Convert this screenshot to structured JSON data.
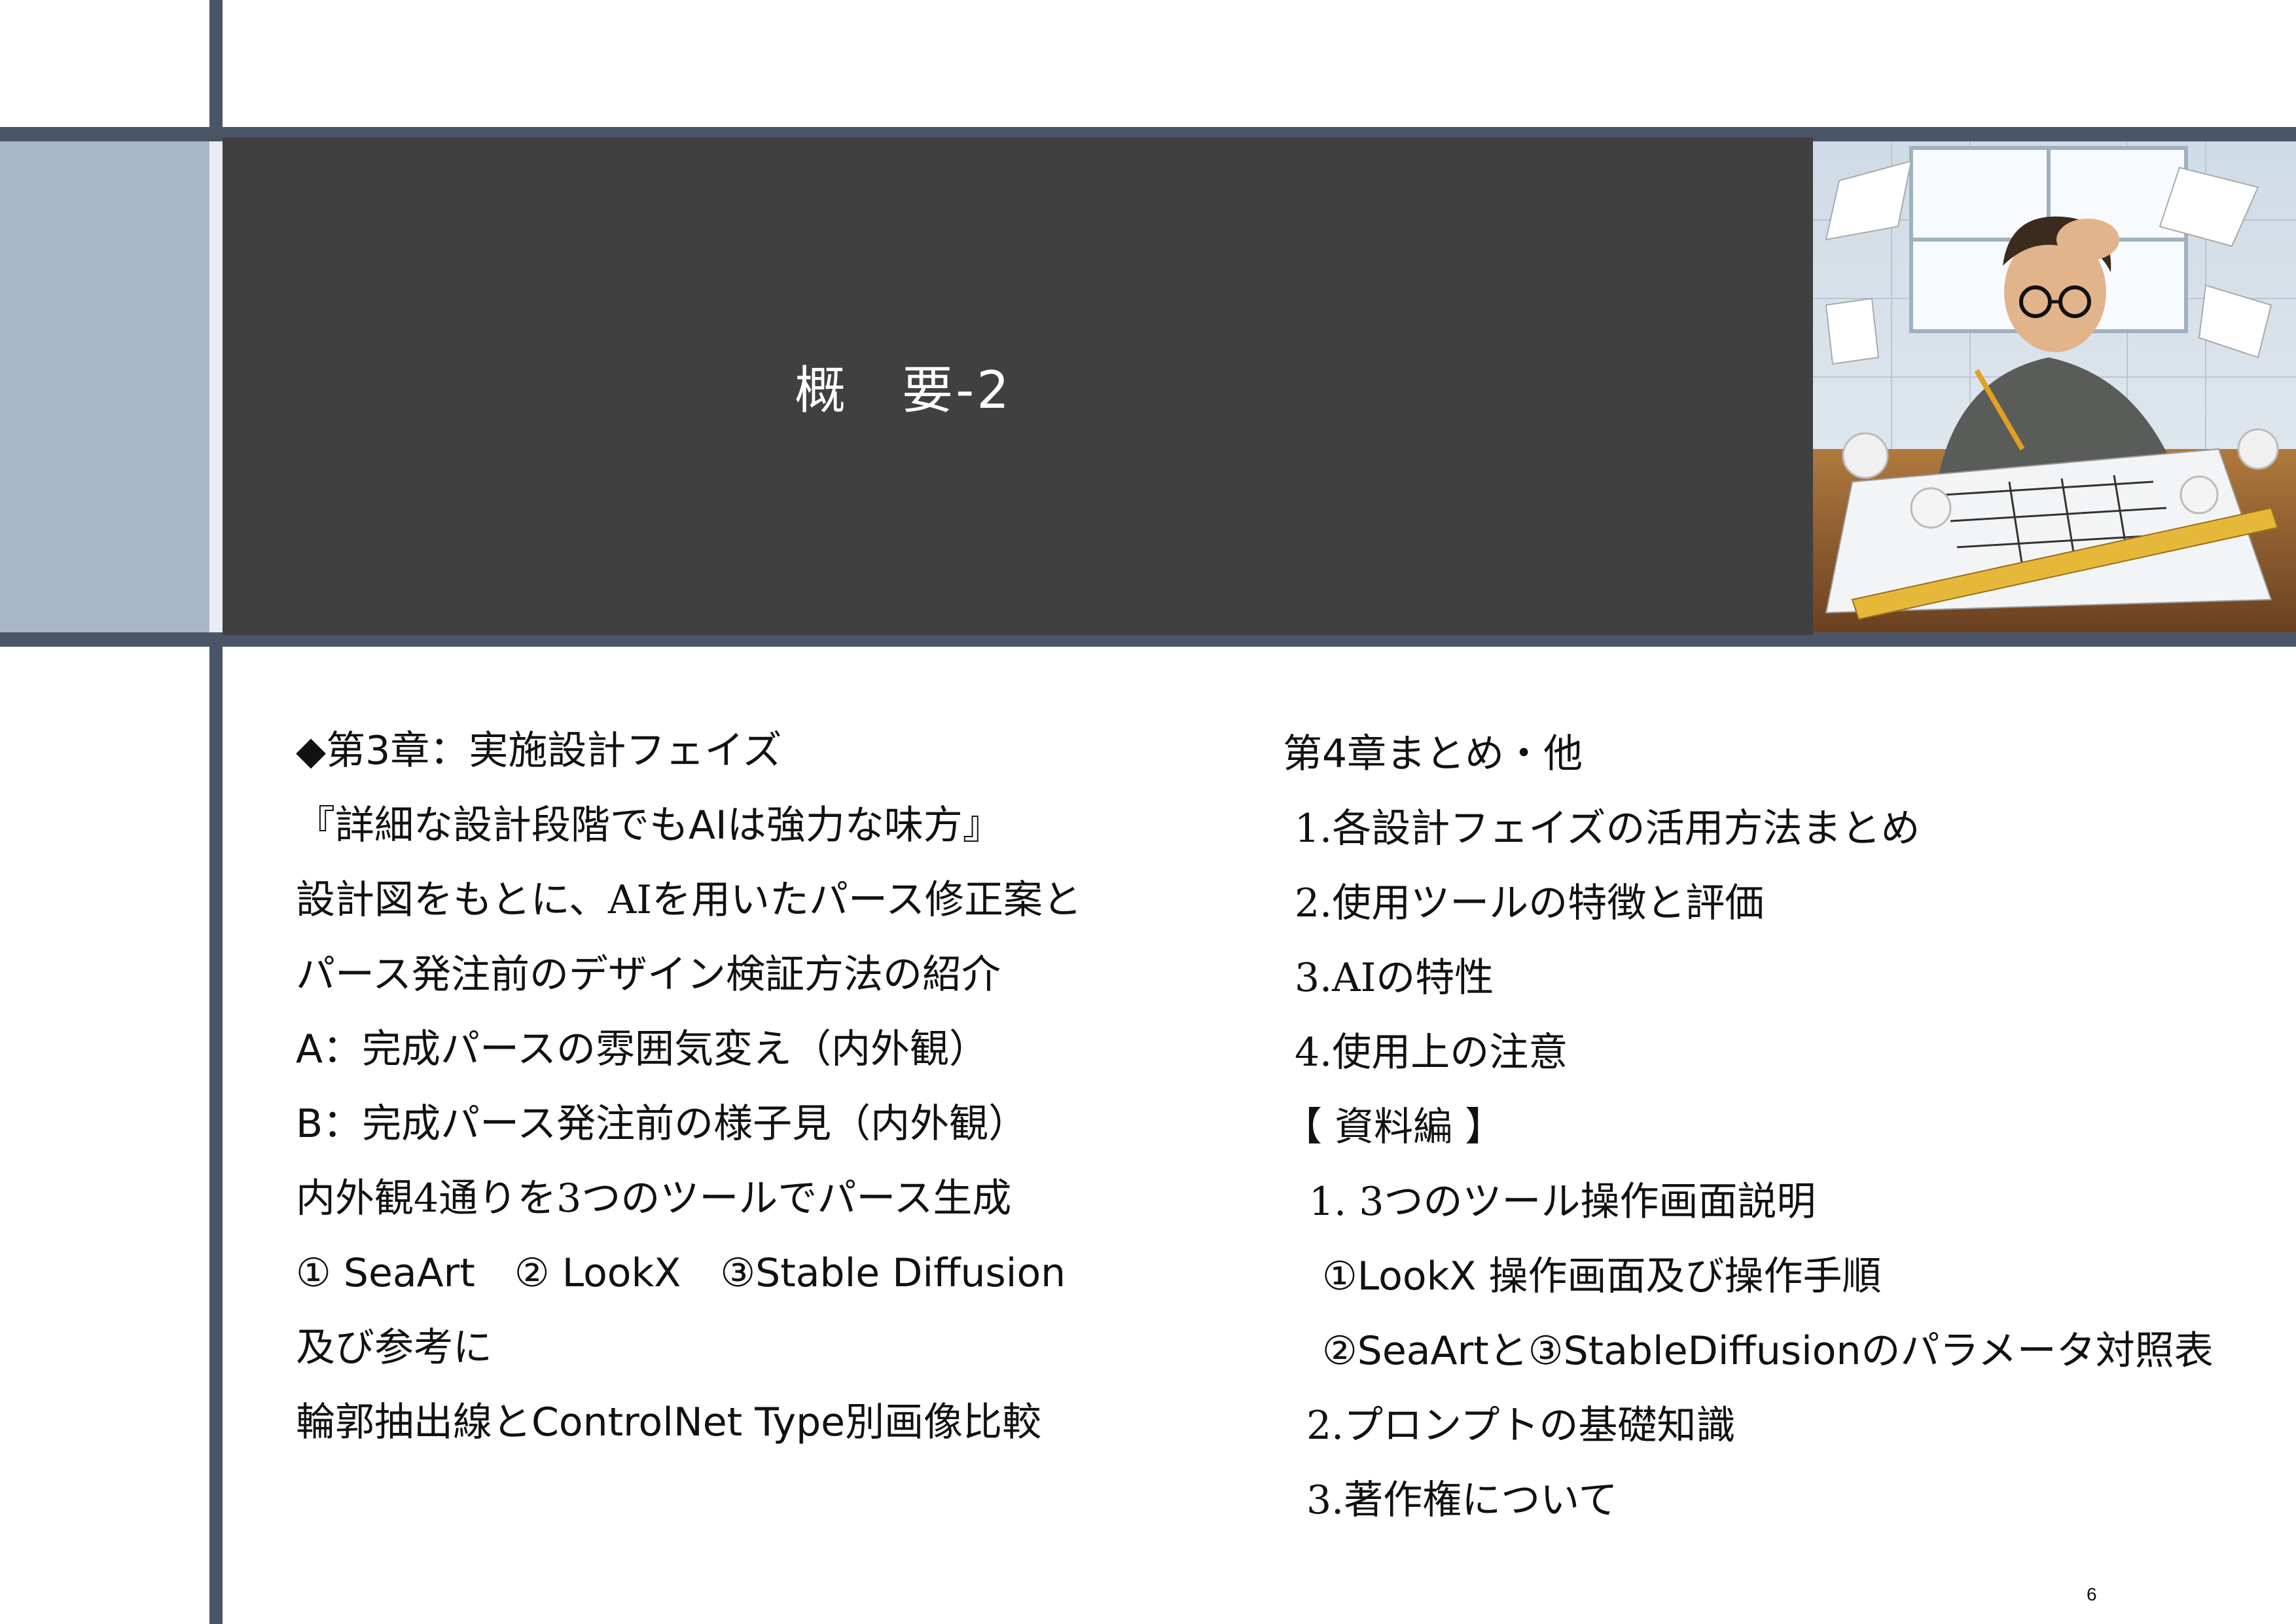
{
  "header": {
    "title": "概　要-2"
  },
  "illustration": {
    "icon": "stressed-architect-illustration"
  },
  "left_column": {
    "heading": "◆第3章：実施設計フェイズ",
    "subtitle": "『詳細な設計段階でもAIは強力な味方』",
    "desc_1": " 設計図をもとに、AIを用いたパース修正案と",
    "desc_2": "パース発注前のデザイン検証方法の紹介",
    "item_a": "A：完成パースの雰囲気変え（内外観）",
    "item_b": "B：完成パース発注前の様子見（内外観）",
    "tools_intro": "内外観4通りを3つのツールでパース生成",
    "tools": "① SeaArt　② LookX　③Stable Diffusion",
    "ref_intro": "及び参考に",
    "ref": "輪郭抽出線とControlNet Type別画像比較"
  },
  "right_column": {
    "heading": "第4章まとめ・他",
    "items": [
      "1.各設計フェイズの活用方法まとめ",
      "2.使用ツールの特徴と評価",
      "3.AIの特性",
      "4.使用上の注意"
    ],
    "appendix_heading": "【 資料編 】",
    "appendix_1": "1.  3つのツール操作画面説明",
    "appendix_1a": "①LookX 操作画面及び操作手順",
    "appendix_1b": "②SeaArtと③StableDiffusionのパラメータ対照表",
    "appendix_2": "2.プロンプトの基礎知識",
    "appendix_3": "3.著作権について"
  },
  "page_number": "6",
  "colors": {
    "accent_rule": "#4a5668",
    "side_block": "#a7b6c9",
    "title_bg": "#404040"
  }
}
